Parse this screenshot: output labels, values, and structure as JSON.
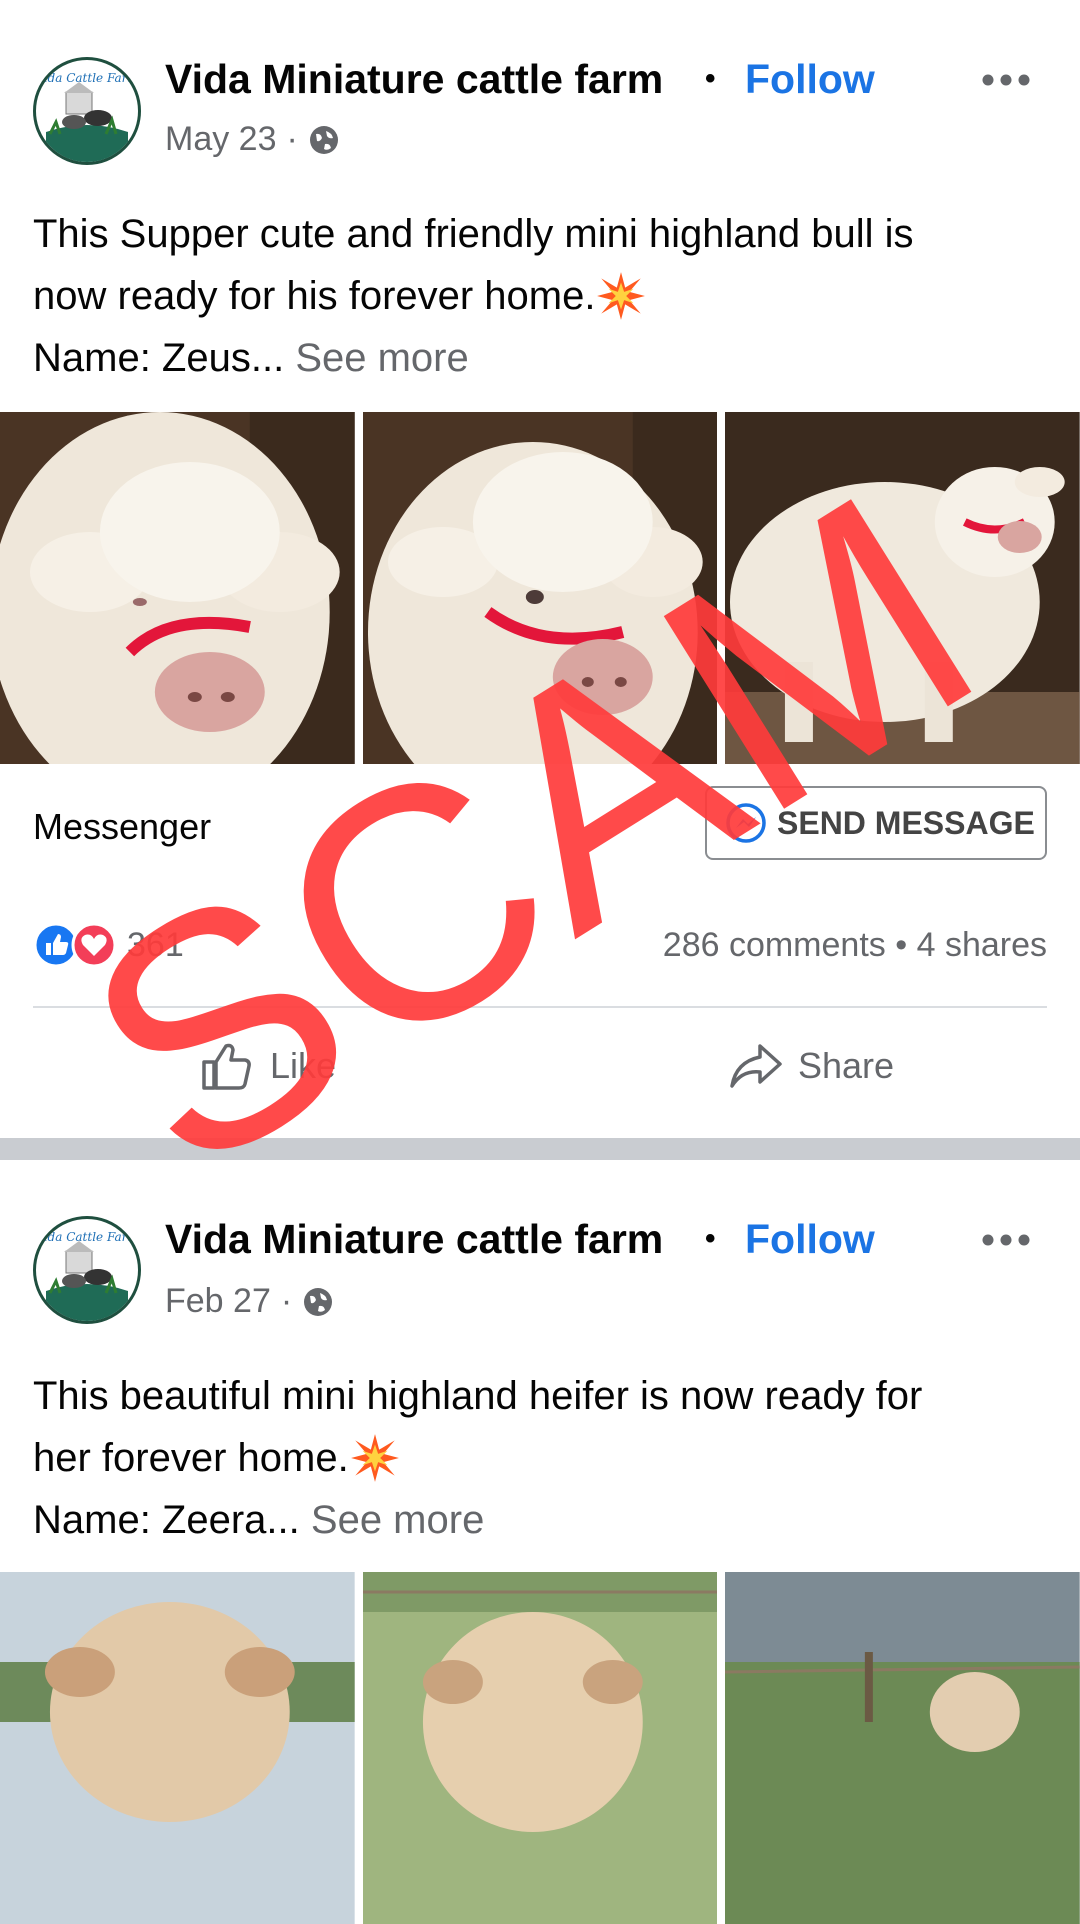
{
  "posts": [
    {
      "page_name": "Vida Miniature cattle farm",
      "separator": "•",
      "follow_label": "Follow",
      "date": "May 23",
      "meta_separator": "·",
      "text_line1": "This Supper cute and friendly mini highland bull is",
      "text_line2": "now ready for his forever home.",
      "text_line3": "Name: Zeus...",
      "see_more": "See more",
      "messenger_label": "Messenger",
      "send_message_label": "SEND MESSAGE",
      "reaction_count": "361",
      "comments": "286 comments",
      "shares": "4 shares",
      "like_label": "Like",
      "share_label": "Share"
    },
    {
      "page_name": "Vida Miniature cattle farm",
      "separator": "•",
      "follow_label": "Follow",
      "date": "Feb 27",
      "meta_separator": "·",
      "text_line1": "This beautiful mini highland heifer is now ready for",
      "text_line2": "her forever home.",
      "text_line3": "Name: Zeera...",
      "see_more": "See more"
    }
  ],
  "avatar_text": "Vida Cattle Farm",
  "overlay_text": "SCAM",
  "icons": {
    "more": "more-horizontal-icon",
    "privacy": "globe-icon",
    "emoji": "collision-emoji",
    "messenger": "messenger-icon",
    "like_reaction": "like-reaction-icon",
    "love_reaction": "love-reaction-icon",
    "like_action": "thumbs-up-icon",
    "share_action": "share-arrow-icon"
  },
  "colors": {
    "follow": "#1b74e4",
    "secondary_text": "#65676b",
    "scam_overlay": "#ff3b3b",
    "divider": "#c9ccd1"
  }
}
